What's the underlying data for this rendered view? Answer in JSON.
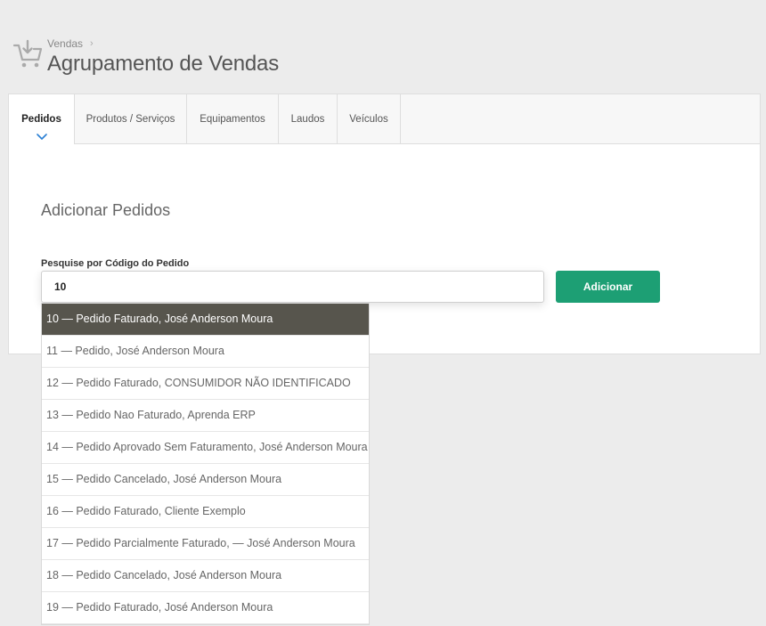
{
  "header": {
    "icon": "cart-download-icon",
    "breadcrumb": "Vendas",
    "title": "Agrupamento de Vendas"
  },
  "tabs": [
    {
      "label": "Pedidos",
      "active": true
    },
    {
      "label": "Produtos / Serviços",
      "active": false
    },
    {
      "label": "Equipamentos",
      "active": false
    },
    {
      "label": "Laudos",
      "active": false
    },
    {
      "label": "Veículos",
      "active": false
    }
  ],
  "main": {
    "section_title": "Adicionar Pedidos",
    "search_label": "Pesquise por Código do Pedido",
    "search_value": "10",
    "add_button": "Adicionar"
  },
  "suggestions": [
    "10 — Pedido Faturado, José Anderson Moura",
    "11 — Pedido, José Anderson Moura",
    "12 — Pedido Faturado, CONSUMIDOR NÃO IDENTIFICADO",
    "13 — Pedido Nao Faturado, Aprenda ERP",
    "14 — Pedido Aprovado Sem Faturamento, José Anderson Moura",
    "15 — Pedido Cancelado, José Anderson Moura",
    "16 — Pedido Faturado, Cliente Exemplo",
    "17 — Pedido Parcialmente Faturado, — José Anderson Moura",
    "18 — Pedido Cancelado, José Anderson Moura",
    "19 — Pedido Faturado, José Anderson Moura"
  ],
  "colors": {
    "accent": "#1d9f74",
    "highlight": "#57554d",
    "tab_indicator": "#2a7fd4"
  }
}
